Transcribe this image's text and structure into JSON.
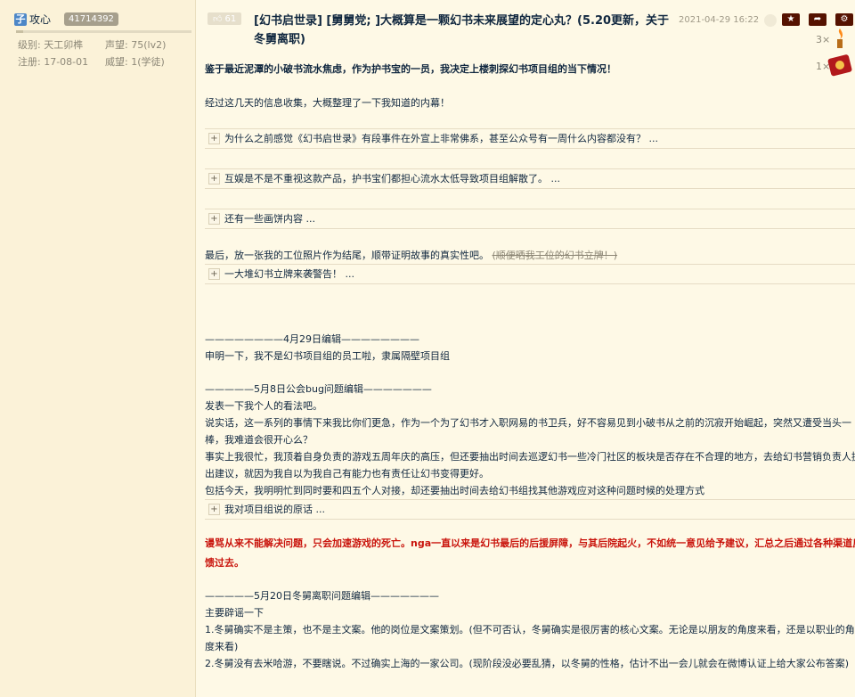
{
  "user": {
    "avatar_char": "子",
    "name": "攻心",
    "uid": "41714392",
    "reputation_fill": 0.04,
    "level_label": "级别:",
    "level_value": "天工卯榫",
    "prestige_label": "声望:",
    "prestige_value": "75(lv2)",
    "register_label": "注册:",
    "register_value": "17-08-01",
    "power_label": "威望:",
    "power_value": "1(学徒)"
  },
  "post": {
    "like_count": "61",
    "title": "[幻书启世录] [舅舅党; ]大概算是一颗幻书未来展望的定心丸？(5.20更新，关于冬舅离职)",
    "timestamp": "2021-04-29 16:22",
    "medals": [
      {
        "count": "3×",
        "icon": "torch-medal-icon"
      },
      {
        "count": "1×",
        "icon": "book-medal-icon"
      }
    ],
    "action_icons": [
      "star-icon",
      "share-icon",
      "settings-icon"
    ],
    "intro_bold": "鉴于最近泥潭的小破书流水焦虑，作为护书宝的一员，我决定上楼刺探幻书项目组的当下情况！",
    "intro": "经过这几天的信息收集，大概整理了一下我知道的内幕！",
    "collapses": [
      "为什么之前感觉《幻书启世录》有段事件在外宣上非常佛系，甚至公众号有一周什么内容都没有？ ...",
      "互娱是不是不重视这款产品，护书宝们都担心流水太低导致项目组解散了。 ...",
      "还有一些画饼内容 ...",
      "一大堆幻书立牌来袭警告！ ...",
      "我对项目组说的原话 ..."
    ],
    "photo_line": "最后，放一张我的工位照片作为结尾，顺带证明故事的真实性吧。",
    "photo_strike": "(顺便晒我工位的幻书立牌！)",
    "edit1_header": "————————4月29日编辑————————",
    "edit1_text": "申明一下，我不是幻书项目组的员工啦，隶属隔壁项目组",
    "edit2_header": "—————5月8日公会bug问题编辑———————",
    "edit2_lines": [
      "发表一下我个人的看法吧。",
      "说实话，这一系列的事情下来我比你们更急，作为一个为了幻书才入职网易的书卫兵，好不容易见到小破书从之前的沉寂开始崛起，突然又遭受当头一",
      "棒，我难道会很开心么？",
      "事实上我很忙，我顶着自身负责的游戏五周年庆的高压，但还要抽出时间去巡逻幻书一些冷门社区的板块是否存在不合理的地方，去给幻书营销负责人提",
      "出建议，就因为我自以为我自己有能力也有责任让幻书变得更好。",
      "包括今天，我明明忙到同时要和四五个人对接，却还要抽出时间去给幻书组找其他游戏应对这种问题时候的处理方式"
    ],
    "red_lines": [
      "谩骂从来不能解决问题，只会加速游戏的死亡。nga一直以来是幻书最后的后援屏障，与其后院起火，不如统一意见给予建议，汇总之后通过各种渠道反",
      "馈过去。"
    ],
    "edit3_header": "—————5月20日冬舅离职问题编辑———————",
    "edit3_lines": [
      "主要辟谣一下",
      "1.冬舅确实不是主策，也不是主文案。他的岗位是文案策划。(但不可否认，冬舅确实是很厉害的核心文案。无论是以朋友的角度来看，还是以职业的角",
      "度来看)",
      "2.冬舅没有去米哈游，不要瞎说。不过确实上海的一家公司。(现阶段没必要乱猜，以冬舅的性格，估计不出一会儿就会在微博认证上给大家公布答案)"
    ]
  }
}
